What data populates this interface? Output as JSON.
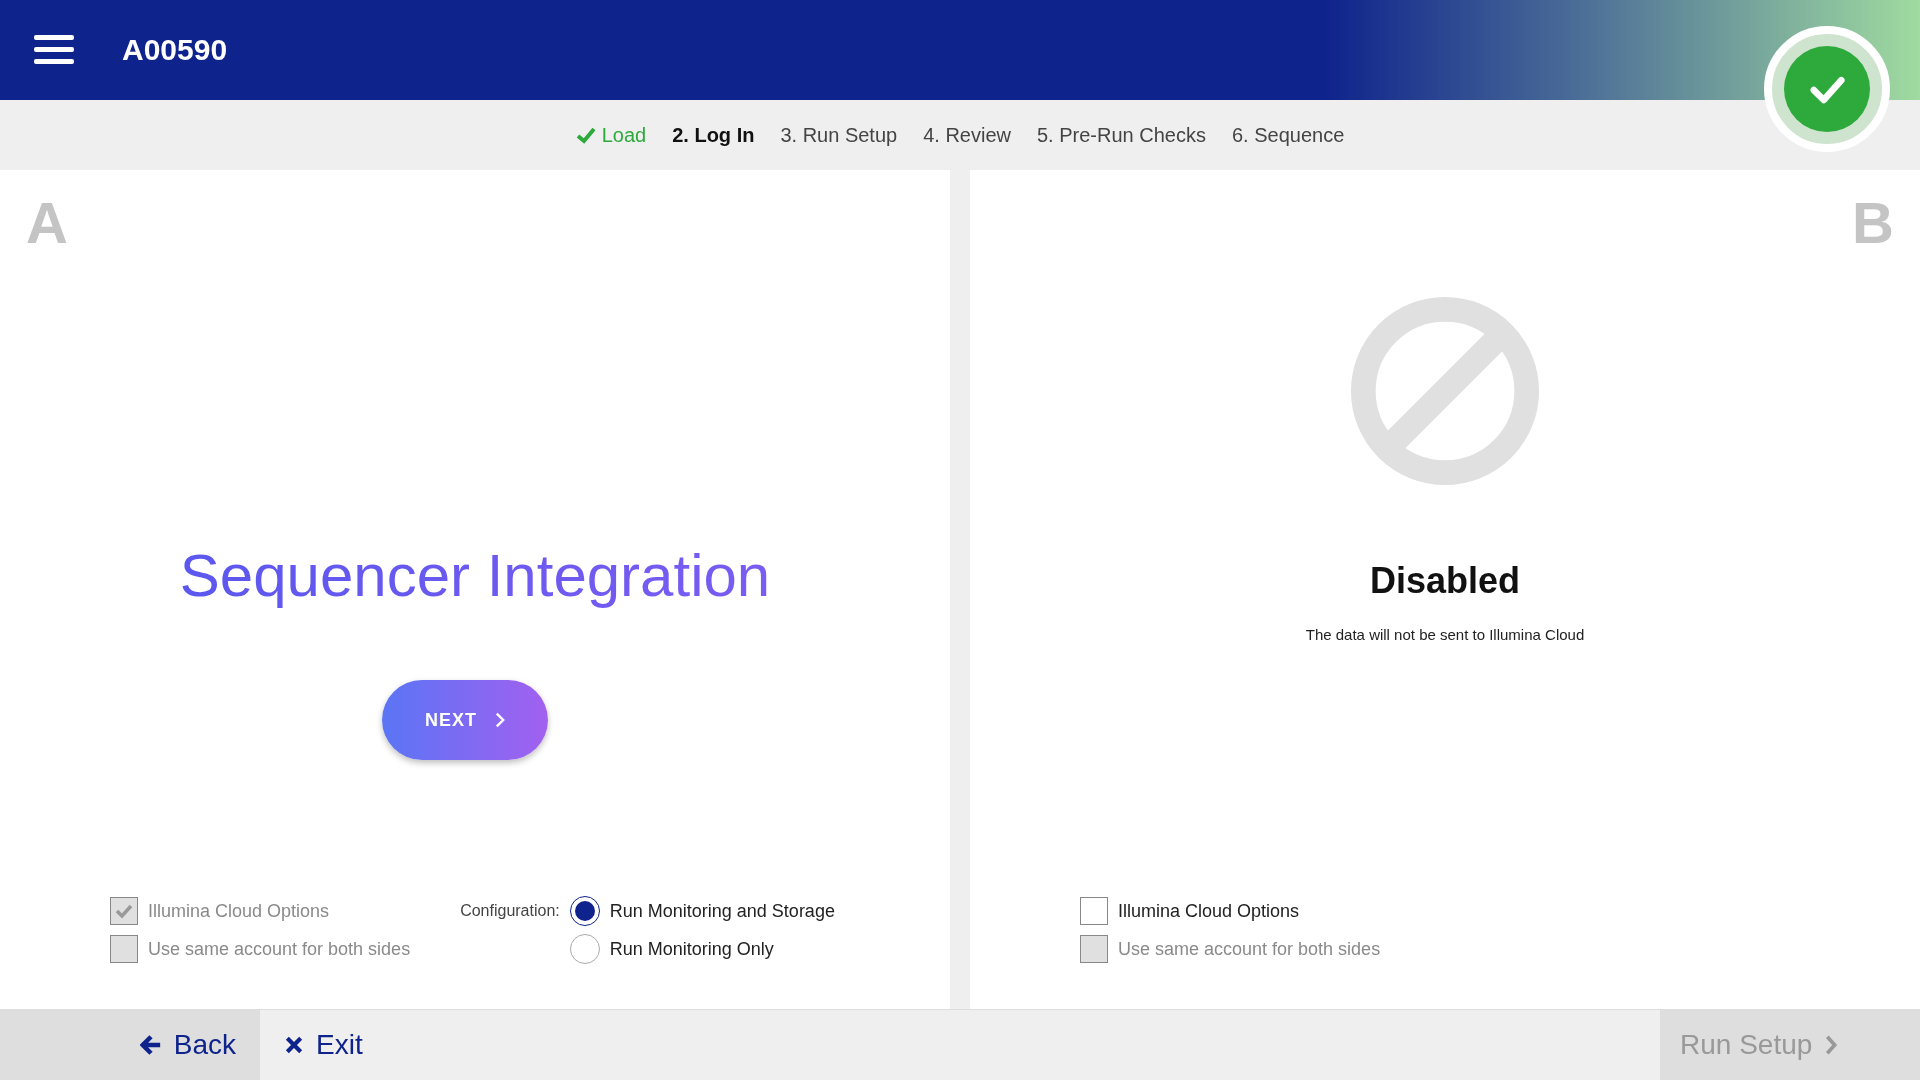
{
  "header": {
    "title": "A00590"
  },
  "steps": [
    {
      "label": "Load",
      "done": true,
      "selected": false
    },
    {
      "label": "2. Log In",
      "done": false,
      "selected": true
    },
    {
      "label": "3. Run Setup",
      "done": false,
      "selected": false
    },
    {
      "label": "4. Review",
      "done": false,
      "selected": false
    },
    {
      "label": "5. Pre-Run Checks",
      "done": false,
      "selected": false
    },
    {
      "label": "6. Sequence",
      "done": false,
      "selected": false
    }
  ],
  "side_a": {
    "letter": "A",
    "title": "Sequencer Integration",
    "next_button": "NEXT",
    "options": [
      {
        "label": "Illumina Cloud Options",
        "checked": true,
        "disabled": true
      },
      {
        "label": "Use same account for both sides",
        "checked": false,
        "disabled": true
      }
    ],
    "configuration": {
      "label": "Configuration:",
      "choices": [
        {
          "label": "Run Monitoring and Storage",
          "selected": true
        },
        {
          "label": "Run Monitoring Only",
          "selected": false
        }
      ]
    }
  },
  "side_b": {
    "letter": "B",
    "status": "Disabled",
    "message": "The data will not be sent to Illumina Cloud",
    "options": [
      {
        "label": "Illumina Cloud Options",
        "checked": false,
        "disabled": false
      },
      {
        "label": "Use same account for both sides",
        "checked": false,
        "disabled": true
      }
    ]
  },
  "footer": {
    "back": "Back",
    "exit": "Exit",
    "forward": {
      "label": "Run Setup",
      "disabled": true
    }
  }
}
